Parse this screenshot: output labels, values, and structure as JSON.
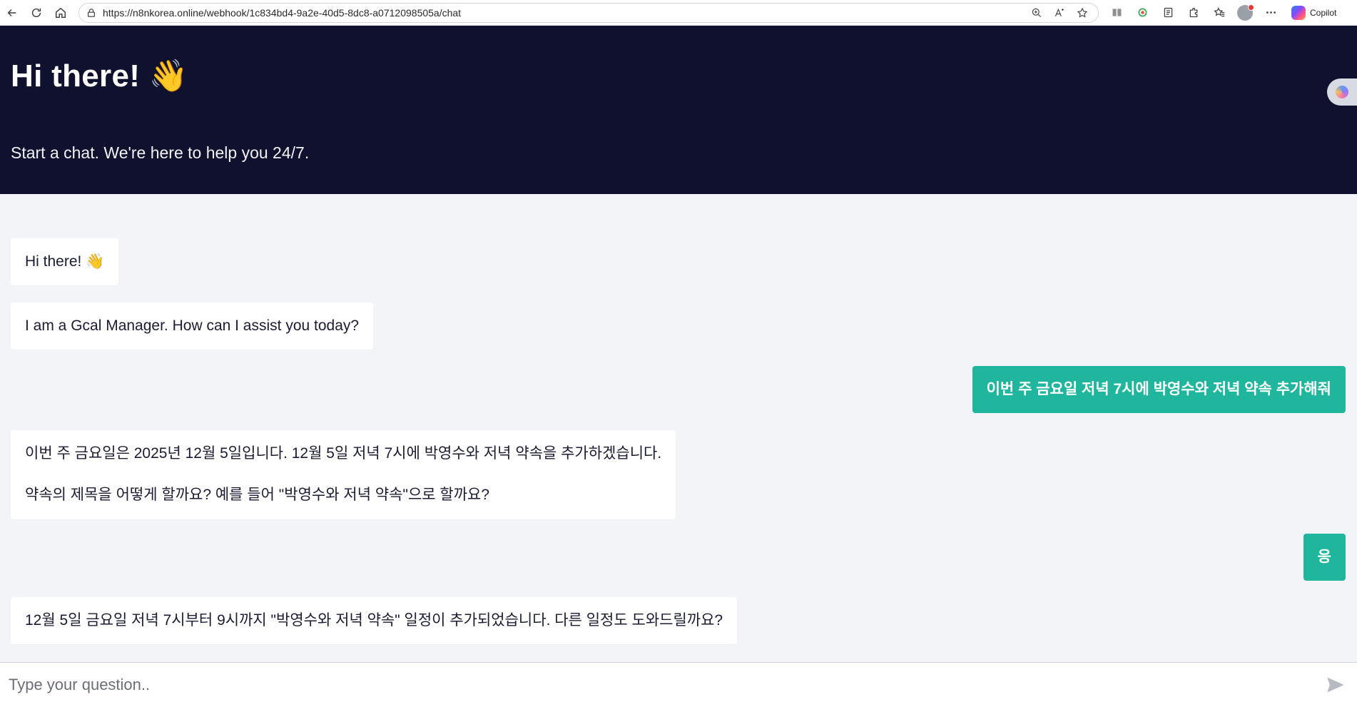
{
  "browser": {
    "url": "https://n8nkorea.online/webhook/1c834bd4-9a2e-40d5-8dc8-a0712098505a/chat",
    "copilot_label": "Copilot",
    "icons": [
      "back-icon",
      "refresh-icon",
      "home-icon",
      "lock-icon",
      "zoom-icon",
      "read-aloud-icon",
      "favorite-star-icon",
      "reading-view-icon",
      "extension-icon",
      "split-screen-icon",
      "extensions-puzzle-icon",
      "favorites-icon",
      "profile-icon",
      "more-icon",
      "copilot-icon"
    ]
  },
  "header": {
    "title": "Hi there! 👋",
    "subtitle": "Start a chat. We're here to help you 24/7.",
    "background_color": "#10112e"
  },
  "messages": [
    {
      "sender": "bot",
      "text": "Hi there! 👋"
    },
    {
      "sender": "bot",
      "text": "I am a Gcal Manager. How can I assist you today?"
    },
    {
      "sender": "user",
      "text": "이번 주 금요일 저녁 7시에 박영수와 저녁 약속 추가해줘"
    },
    {
      "sender": "bot",
      "text_line1": "이번 주 금요일은 2025년 12월 5일입니다. 12월 5일 저녁 7시에 박영수와 저녁 약속을 추가하겠습니다.",
      "text_line2": "약속의 제목을 어떻게 할까요? 예를 들어 \"박영수와 저녁 약속\"으로 할까요?"
    },
    {
      "sender": "user",
      "text": "응"
    },
    {
      "sender": "bot",
      "text": "12월 5일 금요일 저녁 7시부터 9시까지 \"박영수와 저녁 약속\" 일정이 추가되었습니다. 다른 일정도 도와드릴까요?"
    }
  ],
  "input": {
    "placeholder": "Type your question..",
    "value": ""
  },
  "colors": {
    "user_bubble": "#20b69e",
    "bot_bubble": "#ffffff",
    "chat_background": "#f3f4f7"
  }
}
